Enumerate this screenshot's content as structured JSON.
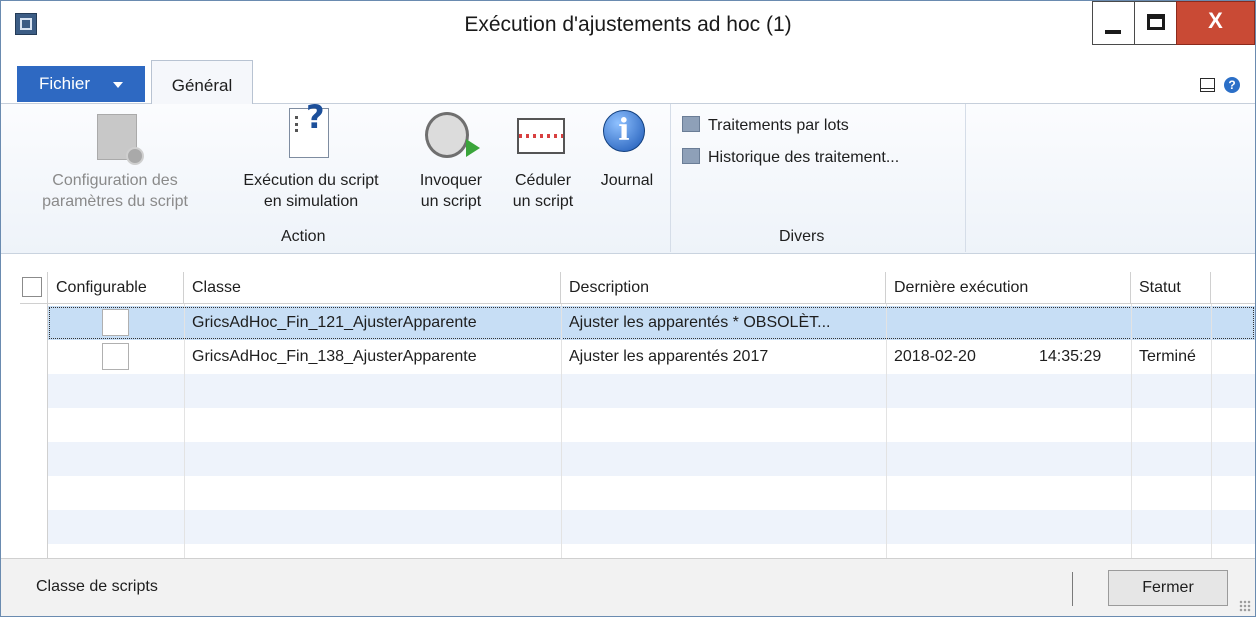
{
  "window": {
    "title": "Exécution d'ajustements ad hoc (1)",
    "close_label": "X"
  },
  "menu": {
    "file_label": "Fichier",
    "tab_general": "Général",
    "help_label": "?"
  },
  "ribbon": {
    "action": {
      "config_line1": "Configuration des",
      "config_line2": "paramètres du script",
      "simulate_line1": "Exécution du script",
      "simulate_line2": "en simulation",
      "invoke_line1": "Invoquer",
      "invoke_line2": "un script",
      "schedule_line1": "Céduler",
      "schedule_line2": "un script",
      "journal": "Journal",
      "group_label": "Action"
    },
    "divers": {
      "batch_label": "Traitements par lots",
      "history_label": "Historique des traitement...",
      "group_label": "Divers"
    }
  },
  "grid": {
    "columns": [
      "Configurable",
      "Classe",
      "Description",
      "Dernière exécution",
      "Statut"
    ],
    "rows": [
      {
        "classe": "GricsAdHoc_Fin_121_AjusterApparente",
        "description": "Ajuster les apparentés * OBSOLÈT...",
        "date": "",
        "time": "",
        "statut": ""
      },
      {
        "classe": "GricsAdHoc_Fin_138_AjusterApparente",
        "description": "Ajuster les apparentés 2017",
        "date": "2018-02-20",
        "time": "14:35:29",
        "statut": "Terminé"
      }
    ]
  },
  "status": {
    "text": "Classe de scripts",
    "close_button": "Fermer"
  }
}
